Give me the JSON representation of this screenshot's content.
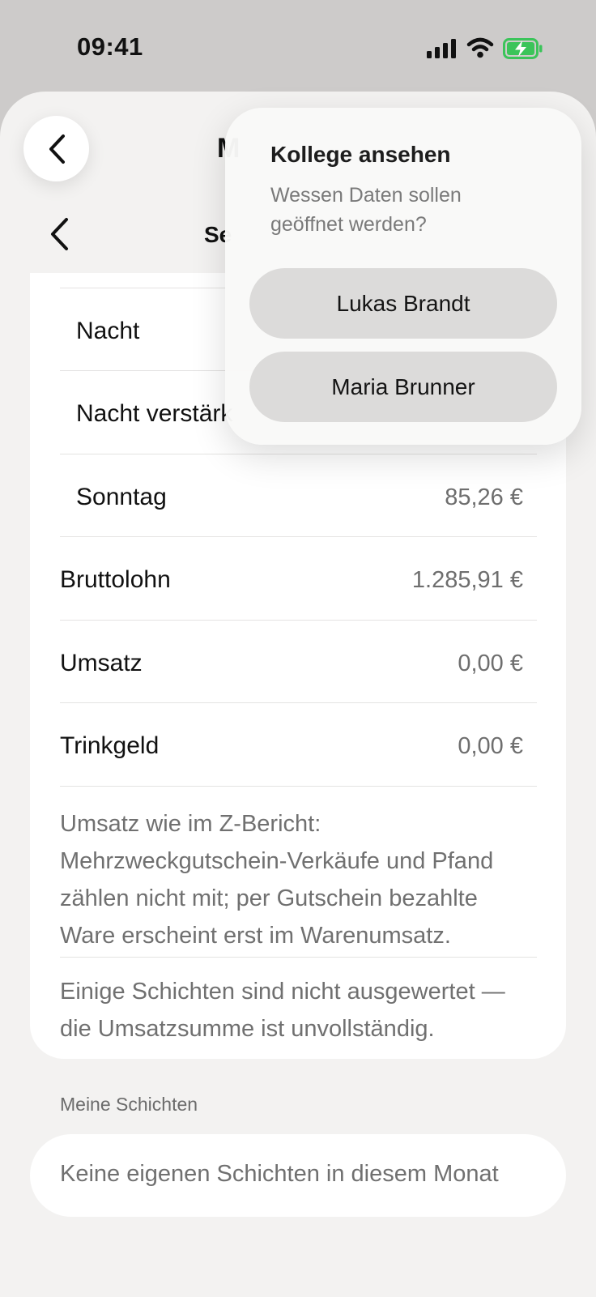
{
  "status_bar": {
    "time": "09:41"
  },
  "header": {
    "title_partial": "M",
    "subtitle_partial": "Se"
  },
  "rows": [
    {
      "label": "Nacht",
      "value": ""
    },
    {
      "label": "Nacht verstärk",
      "value": ""
    },
    {
      "label": "Sonntag",
      "value": "85,26 €"
    },
    {
      "label": "Bruttolohn",
      "value": "1.285,91 €"
    },
    {
      "label": "Umsatz",
      "value": "0,00 €"
    },
    {
      "label": "Trinkgeld",
      "value": "0,00 €"
    }
  ],
  "notes": {
    "z_report": "Umsatz wie im Z-Bericht: Mehrzweckgutschein-Verkäufe und Pfand zählen nicht mit; per Gutschein bezahlte Ware erscheint erst im Warenumsatz.",
    "incomplete": "Einige Schichten sind nicht ausgewertet — die Umsatzsumme ist unvollständig."
  },
  "shifts": {
    "section_title": "Meine Schichten",
    "empty_text": "Keine eigenen Schichten in diesem Monat"
  },
  "popover": {
    "title": "Kollege ansehen",
    "subtitle": "Wessen Daten sollen geöffnet werden?",
    "options": [
      "Lukas Brandt",
      "Maria Brunner"
    ]
  },
  "colors": {
    "sheet_bg": "#f3f2f1",
    "card_bg": "#ffffff",
    "battery_green": "#3bc45a"
  }
}
